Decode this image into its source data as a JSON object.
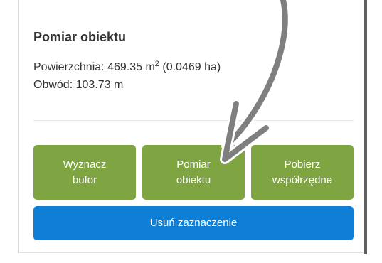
{
  "panel": {
    "title": "Pomiar obiektu",
    "area_label": "Powierzchnia:",
    "area_value": "469.35 m",
    "area_exponent": "2",
    "area_hectares": "(0.0469 ha)",
    "perimeter_label": "Obwód:",
    "perimeter_value": "103.73 m"
  },
  "buttons": {
    "buffer": {
      "line1": "Wyznacz",
      "line2": "bufor"
    },
    "measure": {
      "line1": "Pomiar",
      "line2": "obiektu"
    },
    "coordinates": {
      "line1": "Pobierz",
      "line2": "współrzędne"
    },
    "clear_selection": "Usuń zaznaczenie"
  },
  "colors": {
    "green_button": "#7fa542",
    "blue_button": "#0f7fd6",
    "annotation_arrow": "#7f7f7f",
    "text": "#333333"
  },
  "annotation": {
    "icon": "curved-arrow-pointing-to-measure-button"
  }
}
